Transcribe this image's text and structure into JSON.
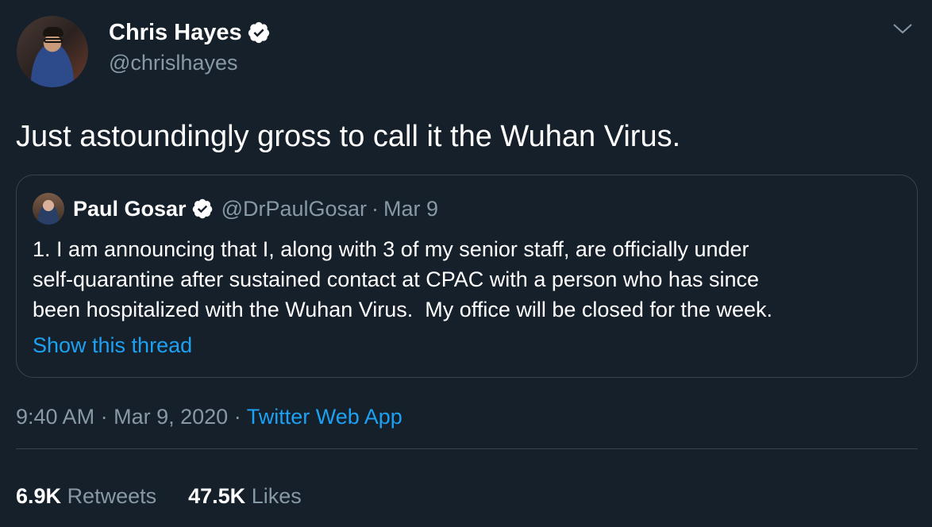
{
  "author": {
    "display_name": "Chris Hayes",
    "handle": "@chrislhayes",
    "verified": true
  },
  "tweet_text": "Just astoundingly gross to call it the Wuhan Virus.",
  "quoted_tweet": {
    "display_name": "Paul Gosar",
    "handle": "@DrPaulGosar",
    "separator": "·",
    "date": "Mar 9",
    "verified": true,
    "text_lines": [
      "1. I am announcing that I, along with 3 of my senior staff, are officially under",
      "self-quarantine after sustained contact at CPAC with a person who has since",
      "been hospitalized with the Wuhan Virus.  My office will be closed for the week."
    ],
    "show_thread_label": "Show this thread"
  },
  "meta": {
    "time": "9:40 AM",
    "separator": "·",
    "date": "Mar 9, 2020",
    "source": "Twitter Web App"
  },
  "stats": {
    "retweets_count": "6.9K",
    "retweets_label": "Retweets",
    "likes_count": "47.5K",
    "likes_label": "Likes"
  },
  "icons": {
    "verified": "verified-badge-icon",
    "menu": "chevron-down-icon"
  },
  "colors": {
    "background": "#15202b",
    "text": "#ffffff",
    "secondary": "#8899a6",
    "accent": "#1da1f2",
    "border": "#38444d"
  }
}
